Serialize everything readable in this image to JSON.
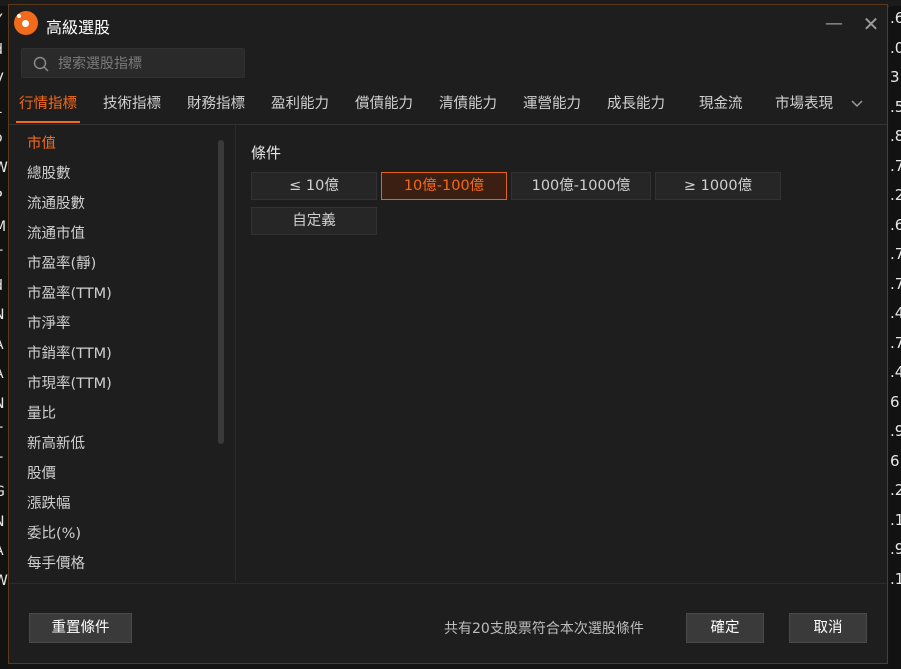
{
  "background_rows_left": [
    "Y",
    "d",
    "V",
    "1",
    "o",
    "W",
    "P",
    "M",
    "T",
    "d",
    "N",
    "A",
    "A",
    "N",
    "T",
    "T",
    "G",
    "N",
    "A",
    "W"
  ],
  "background_rows_right": [
    ".6",
    ".0",
    "3",
    ".5",
    ".8",
    ".7",
    ".2",
    ".6",
    ".7",
    ".7",
    ".4",
    ".7",
    ".4",
    "6",
    ".9",
    "6",
    ".2",
    ".1",
    ".9",
    ".1"
  ],
  "dialog": {
    "title": "高級選股",
    "minimize_glyph": "—",
    "close_glyph": "✕"
  },
  "search": {
    "placeholder": "搜索選股指標",
    "value": ""
  },
  "tabs": [
    {
      "label": "行情指標",
      "active": true
    },
    {
      "label": "技術指標"
    },
    {
      "label": "財務指標"
    },
    {
      "label": "盈利能力"
    },
    {
      "label": "償債能力"
    },
    {
      "label": "清債能力"
    },
    {
      "label": "運營能力"
    },
    {
      "label": "成長能力"
    },
    {
      "label": "現金流"
    },
    {
      "label": "市場表現"
    }
  ],
  "sidebar": {
    "items": [
      {
        "label": "市值",
        "active": true
      },
      {
        "label": "總股數"
      },
      {
        "label": "流通股數"
      },
      {
        "label": "流通市值"
      },
      {
        "label": "市盈率(靜)"
      },
      {
        "label": "市盈率(TTM)"
      },
      {
        "label": "市淨率"
      },
      {
        "label": "市銷率(TTM)"
      },
      {
        "label": "市現率(TTM)"
      },
      {
        "label": "量比"
      },
      {
        "label": "新高新低"
      },
      {
        "label": "股價"
      },
      {
        "label": "漲跌幅"
      },
      {
        "label": "委比(%)"
      },
      {
        "label": "每手價格"
      }
    ]
  },
  "conditions": {
    "title": "條件",
    "options": [
      {
        "label": "≤ 10億"
      },
      {
        "label": "10億-100億",
        "selected": true
      },
      {
        "label": "100億-1000億"
      },
      {
        "label": "≥ 1000億"
      },
      {
        "label": "自定義"
      }
    ]
  },
  "footer": {
    "reset_label": "重置條件",
    "status_text": "共有20支股票符合本次選股條件",
    "confirm_label": "確定",
    "cancel_label": "取消"
  },
  "colors": {
    "accent": "#f26a1b",
    "dialog_bg": "#1e1e1e",
    "selected_bg": "#3b1f12"
  }
}
